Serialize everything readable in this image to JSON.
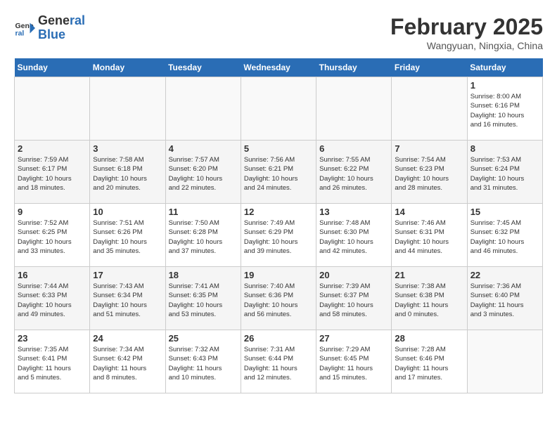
{
  "header": {
    "logo_line1": "General",
    "logo_line2": "Blue",
    "title": "February 2025",
    "subtitle": "Wangyuan, Ningxia, China"
  },
  "weekdays": [
    "Sunday",
    "Monday",
    "Tuesday",
    "Wednesday",
    "Thursday",
    "Friday",
    "Saturday"
  ],
  "weeks": [
    [
      {
        "day": "",
        "info": ""
      },
      {
        "day": "",
        "info": ""
      },
      {
        "day": "",
        "info": ""
      },
      {
        "day": "",
        "info": ""
      },
      {
        "day": "",
        "info": ""
      },
      {
        "day": "",
        "info": ""
      },
      {
        "day": "1",
        "info": "Sunrise: 8:00 AM\nSunset: 6:16 PM\nDaylight: 10 hours\nand 16 minutes."
      }
    ],
    [
      {
        "day": "2",
        "info": "Sunrise: 7:59 AM\nSunset: 6:17 PM\nDaylight: 10 hours\nand 18 minutes."
      },
      {
        "day": "3",
        "info": "Sunrise: 7:58 AM\nSunset: 6:18 PM\nDaylight: 10 hours\nand 20 minutes."
      },
      {
        "day": "4",
        "info": "Sunrise: 7:57 AM\nSunset: 6:20 PM\nDaylight: 10 hours\nand 22 minutes."
      },
      {
        "day": "5",
        "info": "Sunrise: 7:56 AM\nSunset: 6:21 PM\nDaylight: 10 hours\nand 24 minutes."
      },
      {
        "day": "6",
        "info": "Sunrise: 7:55 AM\nSunset: 6:22 PM\nDaylight: 10 hours\nand 26 minutes."
      },
      {
        "day": "7",
        "info": "Sunrise: 7:54 AM\nSunset: 6:23 PM\nDaylight: 10 hours\nand 28 minutes."
      },
      {
        "day": "8",
        "info": "Sunrise: 7:53 AM\nSunset: 6:24 PM\nDaylight: 10 hours\nand 31 minutes."
      }
    ],
    [
      {
        "day": "9",
        "info": "Sunrise: 7:52 AM\nSunset: 6:25 PM\nDaylight: 10 hours\nand 33 minutes."
      },
      {
        "day": "10",
        "info": "Sunrise: 7:51 AM\nSunset: 6:26 PM\nDaylight: 10 hours\nand 35 minutes."
      },
      {
        "day": "11",
        "info": "Sunrise: 7:50 AM\nSunset: 6:28 PM\nDaylight: 10 hours\nand 37 minutes."
      },
      {
        "day": "12",
        "info": "Sunrise: 7:49 AM\nSunset: 6:29 PM\nDaylight: 10 hours\nand 39 minutes."
      },
      {
        "day": "13",
        "info": "Sunrise: 7:48 AM\nSunset: 6:30 PM\nDaylight: 10 hours\nand 42 minutes."
      },
      {
        "day": "14",
        "info": "Sunrise: 7:46 AM\nSunset: 6:31 PM\nDaylight: 10 hours\nand 44 minutes."
      },
      {
        "day": "15",
        "info": "Sunrise: 7:45 AM\nSunset: 6:32 PM\nDaylight: 10 hours\nand 46 minutes."
      }
    ],
    [
      {
        "day": "16",
        "info": "Sunrise: 7:44 AM\nSunset: 6:33 PM\nDaylight: 10 hours\nand 49 minutes."
      },
      {
        "day": "17",
        "info": "Sunrise: 7:43 AM\nSunset: 6:34 PM\nDaylight: 10 hours\nand 51 minutes."
      },
      {
        "day": "18",
        "info": "Sunrise: 7:41 AM\nSunset: 6:35 PM\nDaylight: 10 hours\nand 53 minutes."
      },
      {
        "day": "19",
        "info": "Sunrise: 7:40 AM\nSunset: 6:36 PM\nDaylight: 10 hours\nand 56 minutes."
      },
      {
        "day": "20",
        "info": "Sunrise: 7:39 AM\nSunset: 6:37 PM\nDaylight: 10 hours\nand 58 minutes."
      },
      {
        "day": "21",
        "info": "Sunrise: 7:38 AM\nSunset: 6:38 PM\nDaylight: 11 hours\nand 0 minutes."
      },
      {
        "day": "22",
        "info": "Sunrise: 7:36 AM\nSunset: 6:40 PM\nDaylight: 11 hours\nand 3 minutes."
      }
    ],
    [
      {
        "day": "23",
        "info": "Sunrise: 7:35 AM\nSunset: 6:41 PM\nDaylight: 11 hours\nand 5 minutes."
      },
      {
        "day": "24",
        "info": "Sunrise: 7:34 AM\nSunset: 6:42 PM\nDaylight: 11 hours\nand 8 minutes."
      },
      {
        "day": "25",
        "info": "Sunrise: 7:32 AM\nSunset: 6:43 PM\nDaylight: 11 hours\nand 10 minutes."
      },
      {
        "day": "26",
        "info": "Sunrise: 7:31 AM\nSunset: 6:44 PM\nDaylight: 11 hours\nand 12 minutes."
      },
      {
        "day": "27",
        "info": "Sunrise: 7:29 AM\nSunset: 6:45 PM\nDaylight: 11 hours\nand 15 minutes."
      },
      {
        "day": "28",
        "info": "Sunrise: 7:28 AM\nSunset: 6:46 PM\nDaylight: 11 hours\nand 17 minutes."
      },
      {
        "day": "",
        "info": ""
      }
    ]
  ]
}
